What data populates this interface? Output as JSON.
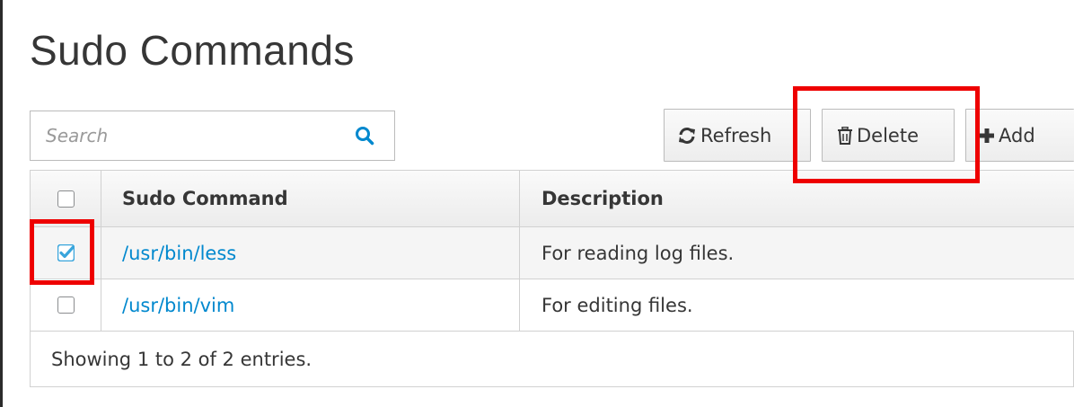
{
  "page": {
    "title": "Sudo Commands"
  },
  "search": {
    "placeholder": "Search",
    "value": "",
    "icon": "search-icon"
  },
  "toolbar": {
    "refresh_label": "Refresh",
    "refresh_icon": "refresh-icon",
    "delete_label": "Delete",
    "delete_icon": "trash-icon",
    "add_label": "Add",
    "add_icon": "plus-icon"
  },
  "table": {
    "columns": [
      "Sudo Command",
      "Description"
    ],
    "rows": [
      {
        "command": "/usr/bin/less",
        "description": "For reading log files.",
        "checked": true
      },
      {
        "command": "/usr/bin/vim",
        "description": "For editing files.",
        "checked": false
      }
    ],
    "select_all_checked": false,
    "footer": "Showing 1 to 2 of 2 entries."
  },
  "colors": {
    "link": "#0088ce",
    "highlight": "#ee0000",
    "checkbox_checked": "#39a5dc"
  }
}
